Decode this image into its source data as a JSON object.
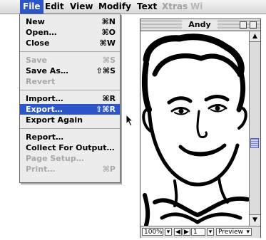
{
  "menubar": {
    "items": [
      {
        "label": "File",
        "state": "active"
      },
      {
        "label": "Edit",
        "state": "normal"
      },
      {
        "label": "View",
        "state": "normal"
      },
      {
        "label": "Modify",
        "state": "normal"
      },
      {
        "label": "Text",
        "state": "normal"
      },
      {
        "label": "Xtras",
        "state": "normal"
      },
      {
        "label": "Wi",
        "state": "dim"
      }
    ]
  },
  "file_menu": {
    "items": [
      {
        "label": "New",
        "shortcut": "⌘N",
        "state": "enabled"
      },
      {
        "label": "Open…",
        "shortcut": "⌘O",
        "state": "enabled"
      },
      {
        "label": "Close",
        "shortcut": "⌘W",
        "state": "enabled"
      },
      {
        "label": "Save",
        "shortcut": "⌘S",
        "state": "disabled"
      },
      {
        "label": "Save As…",
        "shortcut": "⇧⌘S",
        "state": "enabled"
      },
      {
        "label": "Revert",
        "shortcut": "",
        "state": "disabled"
      },
      {
        "label": "Import…",
        "shortcut": "⌘R",
        "state": "enabled"
      },
      {
        "label": "Export…",
        "shortcut": "⇧⌘R",
        "state": "highlighted"
      },
      {
        "label": "Export Again",
        "shortcut": "",
        "state": "enabled"
      },
      {
        "label": "Report…",
        "shortcut": "",
        "state": "enabled"
      },
      {
        "label": "Collect For Output…",
        "shortcut": "",
        "state": "enabled"
      },
      {
        "label": "Page Setup…",
        "shortcut": "",
        "state": "disabled"
      },
      {
        "label": "Print…",
        "shortcut": "⌘P",
        "state": "disabled"
      }
    ]
  },
  "document": {
    "title": "Andy",
    "zoom": "100%",
    "page": "1",
    "view_mode": "Preview"
  },
  "colors": {
    "highlight": "#2b55c8",
    "menu_bg": "#ececec",
    "disabled_text": "#a8a8a8"
  }
}
